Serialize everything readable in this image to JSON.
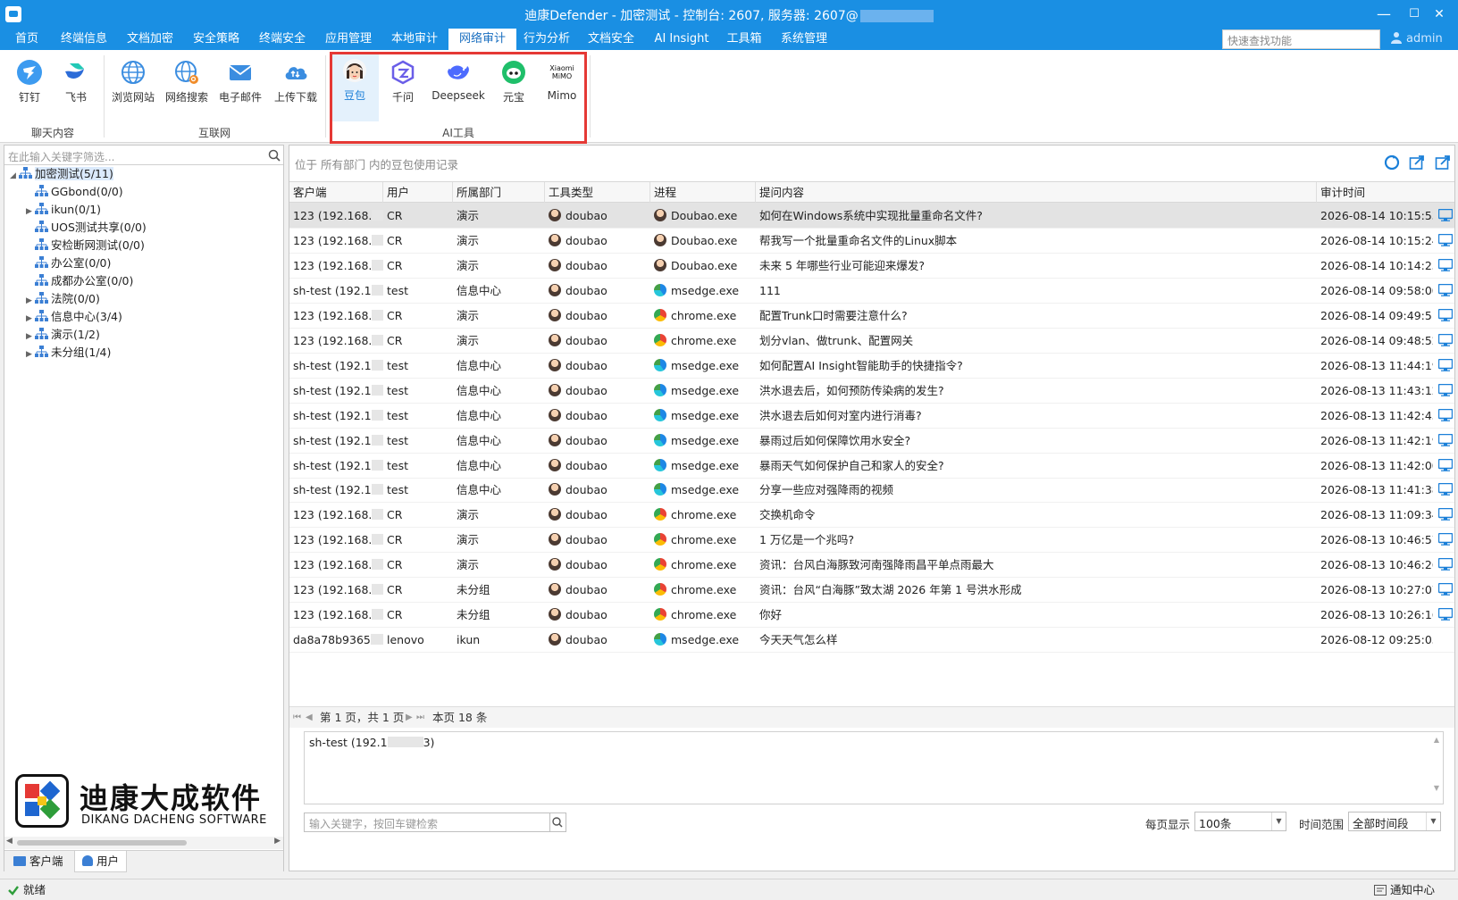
{
  "window": {
    "title": "迪康Defender - 加密测试 - 控制台: 2607, 服务器: 2607@",
    "minimize": "—",
    "maximize": "☐",
    "close": "✕"
  },
  "menu": {
    "items": [
      "首页",
      "终端信息",
      "文档加密",
      "安全策略",
      "终端安全",
      "应用管理",
      "本地审计",
      "网络审计",
      "行为分析",
      "文档安全",
      "AI Insight",
      "工具箱",
      "系统管理"
    ],
    "active_index": 7,
    "quick_search_placeholder": "快速查找功能",
    "user": "admin"
  },
  "ribbon": {
    "buttons": [
      {
        "label": "钉钉",
        "icon": "dingtalk-icon"
      },
      {
        "label": "飞书",
        "icon": "feishu-icon"
      },
      {
        "label": "浏览网站",
        "icon": "globe-icon"
      },
      {
        "label": "网络搜索",
        "icon": "globe-search-icon"
      },
      {
        "label": "电子邮件",
        "icon": "mail-icon"
      },
      {
        "label": "上传下载",
        "icon": "cloud-updown-icon"
      },
      {
        "label": "豆包",
        "icon": "doubao-icon"
      },
      {
        "label": "千问",
        "icon": "qianwen-icon"
      },
      {
        "label": "Deepseek",
        "icon": "deepseek-icon"
      },
      {
        "label": "元宝",
        "icon": "yuanbao-icon"
      },
      {
        "label": "Mimo",
        "icon": "xiaomi-mimo-icon",
        "icon_text": "Xiaomi MiMO"
      }
    ],
    "selected_index": 6,
    "groups": [
      "聊天内容",
      "互联网",
      "AI工具"
    ]
  },
  "tree": {
    "filter_placeholder": "在此输入关键字筛选...",
    "nodes": [
      {
        "label": "加密测试(5/11)",
        "level": 0,
        "expanded": true,
        "selected": true
      },
      {
        "label": "GGbond(0/0)",
        "level": 1,
        "expandable": false
      },
      {
        "label": "ikun(0/1)",
        "level": 1,
        "expandable": true
      },
      {
        "label": "UOS测试共享(0/0)",
        "level": 1,
        "expandable": false
      },
      {
        "label": "安检断网测试(0/0)",
        "level": 1,
        "expandable": false
      },
      {
        "label": "办公室(0/0)",
        "level": 1,
        "expandable": false
      },
      {
        "label": "成都办公室(0/0)",
        "level": 1,
        "expandable": false
      },
      {
        "label": "法院(0/0)",
        "level": 1,
        "expandable": true
      },
      {
        "label": "信息中心(3/4)",
        "level": 1,
        "expandable": true
      },
      {
        "label": "演示(1/2)",
        "level": 1,
        "expandable": true
      },
      {
        "label": "未分组(1/4)",
        "level": 1,
        "expandable": true
      }
    ],
    "logo_cn": "迪康大成软件",
    "logo_en": "DIKANG DACHENG SOFTWARE",
    "tabs": [
      "客户端",
      "用户"
    ],
    "active_tab": 1
  },
  "records": {
    "location": "位于 所有部门 内的豆包使用记录",
    "columns": [
      "客户端",
      "用户",
      "所属部门",
      "工具类型",
      "进程",
      "提问内容",
      "审计时间"
    ],
    "rows": [
      {
        "client": "123 (192.168.",
        "user": "CR",
        "dept": "演示",
        "tool": "doubao",
        "proc": "Doubao.exe",
        "proc_icon": "doubao",
        "question": "如何在Windows系统中实现批量重命名文件?",
        "time": "2026-08-14 10:15:53"
      },
      {
        "client": "123 (192.168.",
        "user": "CR",
        "dept": "演示",
        "tool": "doubao",
        "proc": "Doubao.exe",
        "proc_icon": "doubao",
        "question": "帮我写一个批量重命名文件的Linux脚本",
        "time": "2026-08-14 10:15:24"
      },
      {
        "client": "123 (192.168.",
        "user": "CR",
        "dept": "演示",
        "tool": "doubao",
        "proc": "Doubao.exe",
        "proc_icon": "doubao",
        "question": "未来 5 年哪些行业可能迎来爆发?",
        "time": "2026-08-14 10:14:25"
      },
      {
        "client": "sh-test (192.1",
        "user": "test",
        "dept": "信息中心",
        "tool": "doubao",
        "proc": "msedge.exe",
        "proc_icon": "edge",
        "question": "111",
        "time": "2026-08-14 09:58:00"
      },
      {
        "client": "123 (192.168.",
        "user": "CR",
        "dept": "演示",
        "tool": "doubao",
        "proc": "chrome.exe",
        "proc_icon": "chrome",
        "question": "配置Trunk口时需要注意什么?",
        "time": "2026-08-14 09:49:51"
      },
      {
        "client": "123 (192.168.",
        "user": "CR",
        "dept": "演示",
        "tool": "doubao",
        "proc": "chrome.exe",
        "proc_icon": "chrome",
        "question": "划分vlan、做trunk、配置网关",
        "time": "2026-08-14 09:48:52"
      },
      {
        "client": "sh-test (192.1",
        "user": "test",
        "dept": "信息中心",
        "tool": "doubao",
        "proc": "msedge.exe",
        "proc_icon": "edge",
        "question": "如何配置AI Insight智能助手的快捷指令?",
        "time": "2026-08-13 11:44:19"
      },
      {
        "client": "sh-test (192.1",
        "user": "test",
        "dept": "信息中心",
        "tool": "doubao",
        "proc": "msedge.exe",
        "proc_icon": "edge",
        "question": "洪水退去后，如何预防传染病的发生?",
        "time": "2026-08-13 11:43:12"
      },
      {
        "client": "sh-test (192.1",
        "user": "test",
        "dept": "信息中心",
        "tool": "doubao",
        "proc": "msedge.exe",
        "proc_icon": "edge",
        "question": "洪水退去后如何对室内进行消毒?",
        "time": "2026-08-13 11:42:45"
      },
      {
        "client": "sh-test (192.1",
        "user": "test",
        "dept": "信息中心",
        "tool": "doubao",
        "proc": "msedge.exe",
        "proc_icon": "edge",
        "question": "暴雨过后如何保障饮用水安全?",
        "time": "2026-08-13 11:42:19"
      },
      {
        "client": "sh-test (192.1",
        "user": "test",
        "dept": "信息中心",
        "tool": "doubao",
        "proc": "msedge.exe",
        "proc_icon": "edge",
        "question": "暴雨天气如何保护自己和家人的安全?",
        "time": "2026-08-13 11:42:00"
      },
      {
        "client": "sh-test (192.1",
        "user": "test",
        "dept": "信息中心",
        "tool": "doubao",
        "proc": "msedge.exe",
        "proc_icon": "edge",
        "question": "分享一些应对强降雨的视频",
        "time": "2026-08-13 11:41:38"
      },
      {
        "client": "123 (192.168.",
        "user": "CR",
        "dept": "演示",
        "tool": "doubao",
        "proc": "chrome.exe",
        "proc_icon": "chrome",
        "question": "交换机命令",
        "time": "2026-08-13 11:09:34"
      },
      {
        "client": "123 (192.168.",
        "user": "CR",
        "dept": "演示",
        "tool": "doubao",
        "proc": "chrome.exe",
        "proc_icon": "chrome",
        "question": "1 万亿是一个兆吗?",
        "time": "2026-08-13 10:46:57"
      },
      {
        "client": "123 (192.168.",
        "user": "CR",
        "dept": "演示",
        "tool": "doubao",
        "proc": "chrome.exe",
        "proc_icon": "chrome",
        "question": "资讯：台风白海豚致河南强降雨昌平单点雨最大",
        "time": "2026-08-13 10:46:26"
      },
      {
        "client": "123 (192.168.",
        "user": "CR",
        "dept": "未分组",
        "tool": "doubao",
        "proc": "chrome.exe",
        "proc_icon": "chrome",
        "question": "资讯：台风“白海豚”致太湖 2026 年第 1 号洪水形成",
        "time": "2026-08-13 10:27:07"
      },
      {
        "client": "123 (192.168.",
        "user": "CR",
        "dept": "未分组",
        "tool": "doubao",
        "proc": "chrome.exe",
        "proc_icon": "chrome",
        "question": "你好",
        "time": "2026-08-13 10:26:16"
      },
      {
        "client": "da8a78b9365",
        "user": "lenovo",
        "dept": "ikun",
        "tool": "doubao",
        "proc": "msedge.exe",
        "proc_icon": "edge",
        "question": "今天天气怎么样",
        "time": "2026-08-12 09:25:05"
      }
    ],
    "selected_row": 0,
    "pager_page": "第 1 页，共 1 页",
    "pager_count": "本页 18 条",
    "detail_client": "sh-test (192.1",
    "detail_suffix": "3)",
    "search_placeholder": "输入关键字，按回车键检索",
    "per_page_label": "每页显示",
    "per_page_value": "100条",
    "time_range_label": "时间范围",
    "time_range_value": "全部时间段"
  },
  "status": {
    "text": "就绪",
    "notify": "通知中心"
  },
  "colors": {
    "accent": "#1a8fe3",
    "highlight_border": "#e53935",
    "selection": "#e4f1fc"
  }
}
